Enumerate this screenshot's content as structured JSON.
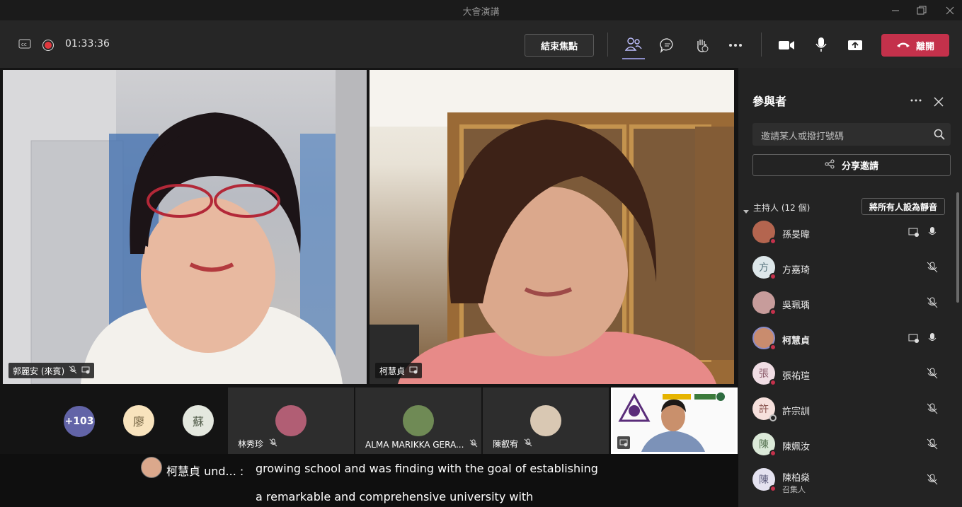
{
  "window": {
    "title": "大會演講"
  },
  "toolbar": {
    "timer": "01:33:36",
    "end_focus_label": "結束焦點",
    "leave_label": "離開"
  },
  "stage": {
    "main_videos": [
      {
        "name": "郭麗安 (來賓)"
      },
      {
        "name": "柯慧貞"
      }
    ],
    "overflow_count": "+103",
    "avatars": [
      {
        "initial": "廖"
      },
      {
        "initial": "蘇"
      }
    ],
    "tiles": [
      {
        "name": "林秀珍"
      },
      {
        "name": "ALMA MARIKKA GERA..."
      },
      {
        "name": "陳叡宥"
      }
    ]
  },
  "captions": {
    "speaker": "柯慧貞 und... :",
    "line1": "growing school and was finding with the goal of establishing",
    "line2": "a remarkable and comprehensive university with"
  },
  "panel": {
    "title": "參與者",
    "invite_placeholder": "邀請某人或撥打號碼",
    "share_invite_label": "分享邀請",
    "presenters_label": "主持人 (12 個)",
    "mute_all_label": "將所有人設為靜音",
    "participants": [
      {
        "name": "孫旻暐",
        "initial": "",
        "sub": ""
      },
      {
        "name": "方嘉琦",
        "initial": "方",
        "sub": ""
      },
      {
        "name": "吳珮瑀",
        "initial": "",
        "sub": ""
      },
      {
        "name": "柯慧貞",
        "initial": "",
        "sub": ""
      },
      {
        "name": "張祐瑄",
        "initial": "張",
        "sub": ""
      },
      {
        "name": "許宗訓",
        "initial": "許",
        "sub": ""
      },
      {
        "name": "陳姵汝",
        "initial": "陳",
        "sub": ""
      },
      {
        "name": "陳柏燊",
        "initial": "陳",
        "sub": "召集人"
      }
    ]
  },
  "colors": {
    "leave": "#c4314b",
    "accent": "#8b8cc7",
    "panel_bg": "#232323"
  }
}
